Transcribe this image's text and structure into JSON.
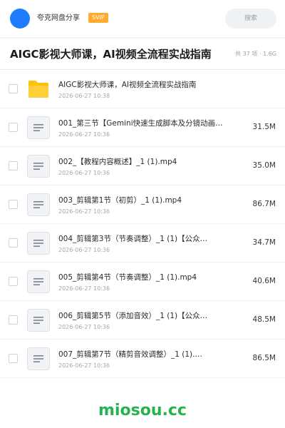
{
  "header": {
    "share_name": "夸克网盘分享",
    "vip_badge": "SVIP",
    "search_placeholder": "搜索"
  },
  "title_bar": {
    "title": "AIGC影视大师课，AI视频全流程实战指南",
    "summary": "共 37 项 · 1.6G"
  },
  "files": [
    {
      "type": "folder",
      "name": "AIGC影视大师课，AI视频全流程实战指南",
      "date": "2026-06-27 10:38",
      "size": ""
    },
    {
      "type": "file",
      "name": "001_第三节【Gemini快速生成脚本及分镜动画…",
      "date": "2026-06-27 10:36",
      "size": "31.5M"
    },
    {
      "type": "file",
      "name": "002_【教程内容概述】_1 (1).mp4",
      "date": "2026-06-27 10:36",
      "size": "35.0M"
    },
    {
      "type": "file",
      "name": "003_剪辑第1节（初剪）_1 (1).mp4",
      "date": "2026-06-27 10:36",
      "size": "86.7M"
    },
    {
      "type": "file",
      "name": "004_剪辑第3节（节奏调整）_1 (1)【公众…",
      "date": "2026-06-27 10:36",
      "size": "34.7M"
    },
    {
      "type": "file",
      "name": "005_剪辑第4节（节奏调整）_1 (1).mp4",
      "date": "2026-06-27 10:36",
      "size": "40.6M"
    },
    {
      "type": "file",
      "name": "006_剪辑第5节（添加音效）_1 (1)【公众…",
      "date": "2026-06-27 10:36",
      "size": "48.5M"
    },
    {
      "type": "file",
      "name": "007_剪辑第7节（精剪音效调整）_1 (1).…",
      "date": "2026-06-27 10:36",
      "size": "86.5M"
    }
  ],
  "footer": {
    "watermark": "miosou.cc"
  },
  "colors": {
    "avatar": "#1f7cff",
    "vip": "#ffab2e",
    "folder": "#ffc107",
    "watermark": "#26b24f"
  }
}
